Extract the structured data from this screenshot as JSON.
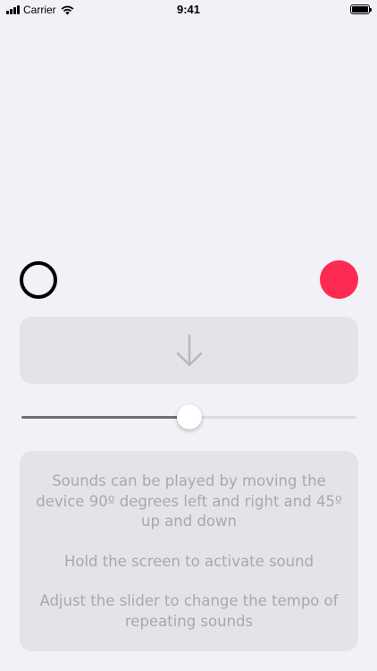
{
  "status_bar": {
    "carrier": "Carrier",
    "time": "9:41"
  },
  "colors": {
    "background": "#f2f1f7",
    "panel": "#e4e3e9",
    "record_red": "#fd2b54",
    "text_muted": "#a9a8ae"
  },
  "controls": {
    "left_circle_icon": "circle-outline-icon",
    "right_circle_icon": "filled-red-circle-icon",
    "arrow_icon": "arrow-down-icon"
  },
  "tempo_slider": {
    "value": 0.5
  },
  "instructions": {
    "line1": "Sounds can be played by moving the device 90º degrees left and right and 45º up and down",
    "line2": "Hold the screen to activate sound",
    "line3": "Adjust the slider to change the tempo of repeating sounds"
  }
}
